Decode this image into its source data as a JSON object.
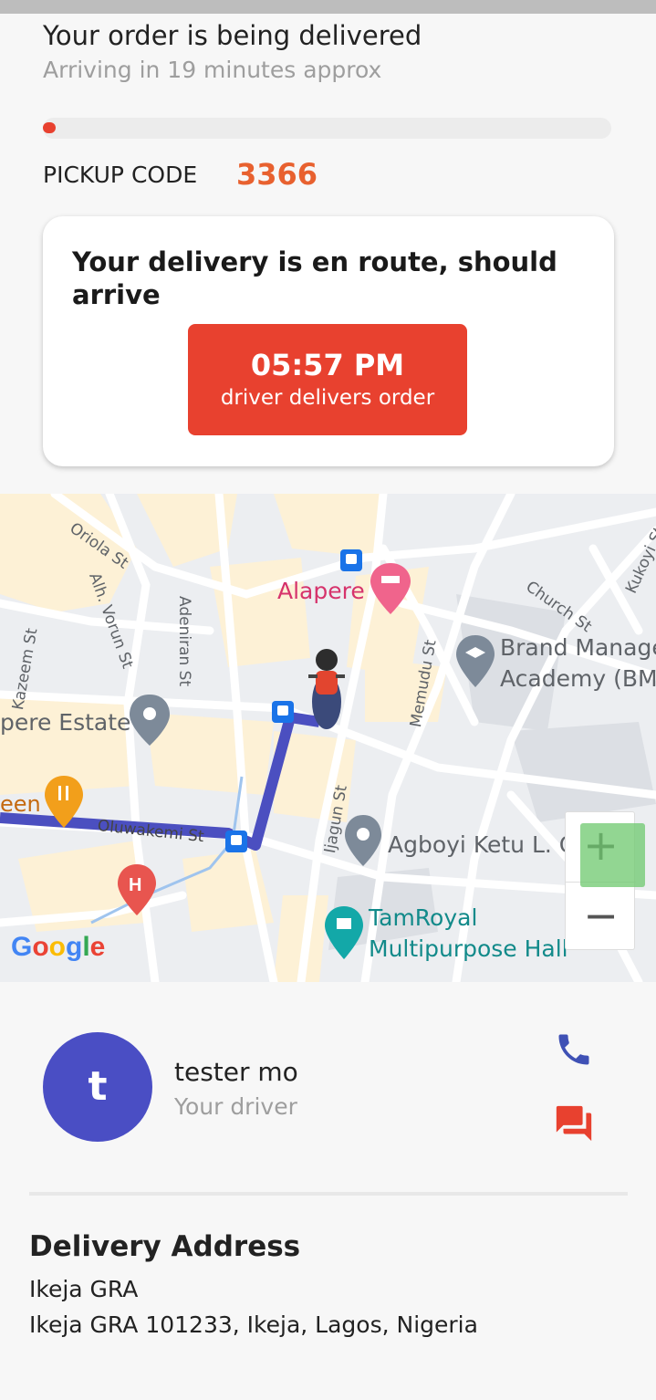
{
  "status": {
    "title": "Your order is being delivered",
    "subtitle": "Arriving in 19 minutes approx",
    "progress_fraction": 0.02
  },
  "pickup": {
    "label": "PICKUP CODE",
    "code": "3366"
  },
  "eta_card": {
    "message": "Your delivery is en route, should arrive",
    "time": "05:57 PM",
    "caption": "driver delivers order"
  },
  "map": {
    "labels": {
      "oriola": "Oriola St",
      "alh_vorun": "Alh. Vorun St",
      "adeniran": "Adeniran St",
      "kazeem": "Kazeem St",
      "alapere": "Alapere",
      "church": "Church St",
      "kukoyi": "Kukoyi St",
      "memudu": "Memudu St",
      "brand_1": "Brand Manage",
      "brand_2": "Academy (BM",
      "estate": "pere Estate",
      "een": "een",
      "oluwakemi": "Oluwakemi St",
      "ijagun": "Ijagun St",
      "agboyi": "Agboyi Ketu L. C",
      "tamroyal_1": "TamRoyal",
      "tamroyal_2": "Multipurpose Hall"
    },
    "zoom_in": "+",
    "zoom_out": "−",
    "attribution": "Google"
  },
  "driver": {
    "initial": "t",
    "name": "tester mo",
    "role": "Your driver"
  },
  "address": {
    "title": "Delivery Address",
    "line1": "Ikeja GRA",
    "line2": "Ikeja GRA 101233, Ikeja, Lagos, Nigeria"
  },
  "colors": {
    "accent": "#e8412f",
    "code": "#e8612f",
    "avatar": "#4a4ec4",
    "route": "#4b4fc0"
  },
  "icons": [
    "phone-icon",
    "chat-icon",
    "location-pin-icon",
    "bus-stop-icon",
    "hotel-icon",
    "restaurant-icon",
    "hospital-icon",
    "school-icon",
    "landmark-icon",
    "delivery-rider-icon"
  ]
}
